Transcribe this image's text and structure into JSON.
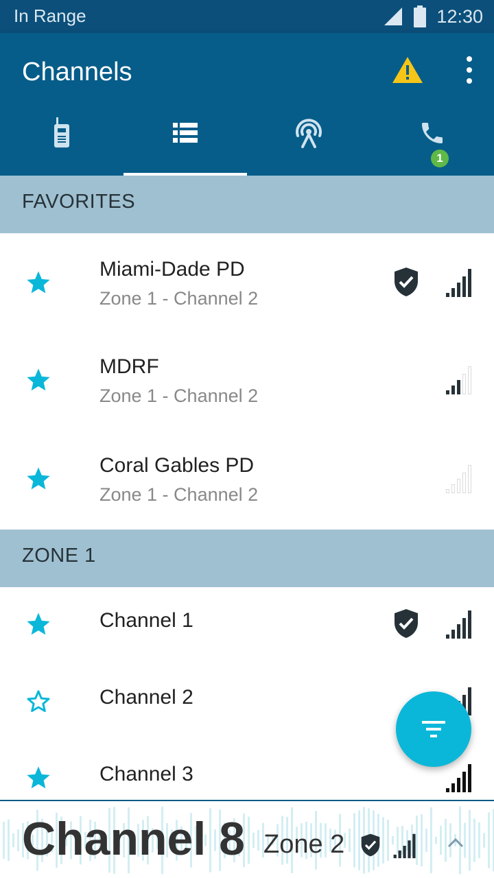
{
  "status_bar": {
    "network_text": "In Range",
    "time": "12:30"
  },
  "app_bar": {
    "title": "Channels",
    "tabs": [
      {
        "icon": "radio-icon",
        "selected": false
      },
      {
        "icon": "list-icon",
        "selected": true
      },
      {
        "icon": "broadcast-icon",
        "selected": false
      },
      {
        "icon": "phone-icon",
        "selected": false,
        "badge": "1"
      }
    ]
  },
  "sections": {
    "favorites_label": "FAVORITES",
    "zone1_label": "ZONE 1"
  },
  "favorites": [
    {
      "title": "Miami-Dade PD",
      "subtitle": "Zone 1 - Channel 2",
      "starred": true,
      "secure": true,
      "signal_bars": 4
    },
    {
      "title": "MDRF",
      "subtitle": "Zone 1 - Channel 2",
      "starred": true,
      "secure": false,
      "signal_bars": 2
    },
    {
      "title": "Coral Gables PD",
      "subtitle": "Zone 1 - Channel 2",
      "starred": true,
      "secure": false,
      "signal_bars": 0
    }
  ],
  "zone1": [
    {
      "title": "Channel 1",
      "starred": true,
      "secure": true,
      "signal_bars": 4
    },
    {
      "title": "Channel 2",
      "starred": false,
      "secure": false,
      "signal_bars": 4
    },
    {
      "title": "Channel 3",
      "starred": true,
      "secure": false,
      "signal_bars": 4
    }
  ],
  "now_playing": {
    "channel": "Channel 8",
    "zone": "Zone 2",
    "secure": true,
    "signal_bars": 4
  },
  "colors": {
    "primary": "#075d89",
    "status": "#0b4f7a",
    "accent": "#0ab7d9",
    "section": "#9fc0d1",
    "warning": "#f5c518",
    "badge": "#5fb847"
  }
}
